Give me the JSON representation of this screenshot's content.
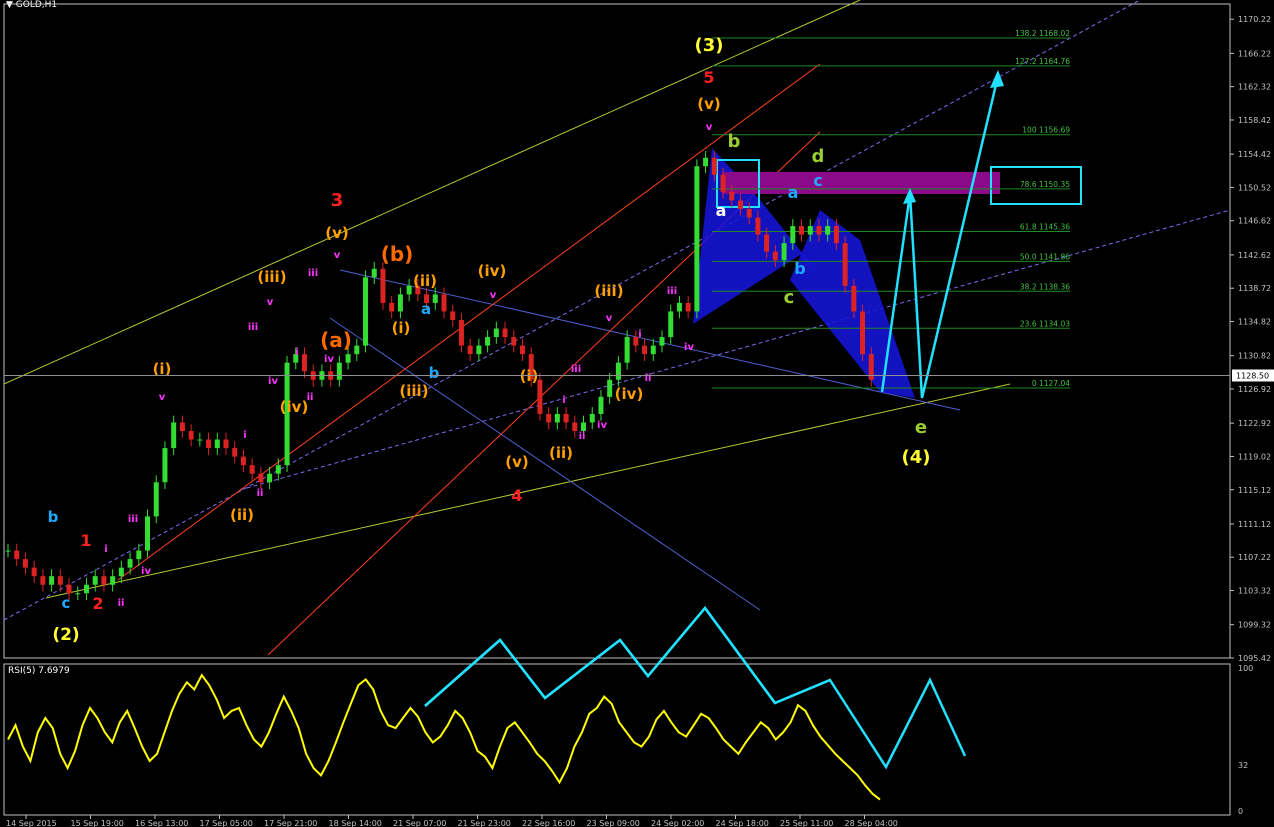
{
  "header": {
    "symbol": "GOLD,H1"
  },
  "rsi": {
    "title": "RSI(5) 7.6979",
    "scale_labels": [
      "100",
      "32",
      "0"
    ],
    "values": [
      50,
      60,
      45,
      35,
      55,
      65,
      58,
      40,
      30,
      42,
      60,
      72,
      65,
      55,
      48,
      62,
      70,
      58,
      45,
      35,
      40,
      55,
      70,
      82,
      90,
      85,
      95,
      88,
      78,
      65,
      70,
      72,
      60,
      50,
      45,
      55,
      68,
      80,
      70,
      58,
      40,
      30,
      25,
      35,
      48,
      62,
      75,
      88,
      92,
      85,
      70,
      60,
      58,
      65,
      72,
      66,
      55,
      48,
      52,
      60,
      70,
      65,
      55,
      42,
      38,
      30,
      45,
      58,
      62,
      55,
      48,
      40,
      35,
      28,
      20,
      30,
      45,
      55,
      68,
      72,
      80,
      75,
      62,
      55,
      48,
      45,
      52,
      64,
      70,
      62,
      55,
      52,
      60,
      68,
      65,
      58,
      50,
      45,
      40,
      48,
      55,
      62,
      58,
      50,
      55,
      62,
      74,
      70,
      60,
      52,
      46,
      40,
      35,
      30,
      25,
      18,
      12,
      8
    ]
  },
  "price_axis": {
    "labels": [
      "1170.22",
      "1166.22",
      "1162.32",
      "1158.42",
      "1154.42",
      "1150.52",
      "1146.62",
      "1142.62",
      "1138.72",
      "1134.82",
      "1130.82",
      "1126.92",
      "1122.92",
      "1119.02",
      "1115.12",
      "1111.12",
      "1107.22",
      "1103.32",
      "1099.32",
      "1095.42"
    ],
    "current": "1128.50"
  },
  "time_axis": {
    "labels": [
      "14 Sep 2015",
      "15 Sep 19:00",
      "16 Sep 13:00",
      "17 Sep 05:00",
      "17 Sep 21:00",
      "18 Sep 14:00",
      "21 Sep 07:00",
      "21 Sep 23:00",
      "22 Sep 16:00",
      "23 Sep 09:00",
      "24 Sep 02:00",
      "24 Sep 18:00",
      "25 Sep 11:00",
      "28 Sep 04:00"
    ]
  },
  "fib_levels": [
    {
      "label": "138.2 1168.02",
      "price": 1168.02
    },
    {
      "label": "127.2 1164.76",
      "price": 1164.76
    },
    {
      "label": "100 1156.69",
      "price": 1156.69
    },
    {
      "label": "78.6 1150.35",
      "price": 1150.35
    },
    {
      "label": "61.8 1145.36",
      "price": 1145.36
    },
    {
      "label": "50.0 1141.86",
      "price": 1141.86
    },
    {
      "label": "38.2 1138.36",
      "price": 1138.36
    },
    {
      "label": "23.6 1134.03",
      "price": 1134.03
    },
    {
      "label": "0 1127.04",
      "price": 1127.04
    }
  ],
  "wave_labels": [
    {
      "text": "(2)",
      "color": "#ffff33"
    },
    {
      "text": "b",
      "color": "#1fa8ff"
    },
    {
      "text": "c",
      "color": "#1fa8ff"
    },
    {
      "text": "1",
      "color": "#ff2020"
    },
    {
      "text": "2",
      "color": "#ff2020"
    },
    {
      "text": "i",
      "color": "#ff33ff"
    },
    {
      "text": "ii",
      "color": "#ff33ff"
    },
    {
      "text": "iii",
      "color": "#ff33ff"
    },
    {
      "text": "iv",
      "color": "#ff33ff"
    },
    {
      "text": "(i)",
      "color": "#ffa000"
    },
    {
      "text": "v",
      "color": "#ff33ff"
    },
    {
      "text": "(ii)",
      "color": "#ffa000"
    },
    {
      "text": "ii",
      "color": "#ff33ff"
    },
    {
      "text": "i",
      "color": "#ff33ff"
    },
    {
      "text": "iii",
      "color": "#ff33ff"
    },
    {
      "text": "iv",
      "color": "#ff33ff"
    },
    {
      "text": "(iii)",
      "color": "#ffa000"
    },
    {
      "text": "v",
      "color": "#ff33ff"
    },
    {
      "text": "(iv)",
      "color": "#ffa000"
    },
    {
      "text": "i",
      "color": "#ff33ff"
    },
    {
      "text": "ii",
      "color": "#ff33ff"
    },
    {
      "text": "iii",
      "color": "#ff33ff"
    },
    {
      "text": "3",
      "color": "#ff2020"
    },
    {
      "text": "(v)",
      "color": "#ffa000"
    },
    {
      "text": "v",
      "color": "#ff33ff"
    },
    {
      "text": "iv",
      "color": "#ff33ff"
    },
    {
      "text": "(a)",
      "color": "#ff6a00"
    },
    {
      "text": "(b)",
      "color": "#ff6a00"
    },
    {
      "text": "(ii)",
      "color": "#ffa000"
    },
    {
      "text": "(i)",
      "color": "#ffa000"
    },
    {
      "text": "a",
      "color": "#1fa8ff"
    },
    {
      "text": "b",
      "color": "#1fa8ff"
    },
    {
      "text": "(iii)",
      "color": "#ffa000"
    },
    {
      "text": "(iv)",
      "color": "#ffa000"
    },
    {
      "text": "v",
      "color": "#ff33ff"
    },
    {
      "text": "(i)",
      "color": "#ffa000"
    },
    {
      "text": "(v)",
      "color": "#ffa000"
    },
    {
      "text": "4",
      "color": "#ff2020"
    },
    {
      "text": "(ii)",
      "color": "#ffa000"
    },
    {
      "text": "i",
      "color": "#ff33ff"
    },
    {
      "text": "iii",
      "color": "#ff33ff"
    },
    {
      "text": "ii",
      "color": "#ff33ff"
    },
    {
      "text": "iv",
      "color": "#ff33ff"
    },
    {
      "text": "(iv)",
      "color": "#ffa000"
    },
    {
      "text": "ii",
      "color": "#ff33ff"
    },
    {
      "text": "(iii)",
      "color": "#ffa000"
    },
    {
      "text": "v",
      "color": "#ff33ff"
    },
    {
      "text": "i",
      "color": "#ff33ff"
    },
    {
      "text": "iii",
      "color": "#ff33ff"
    },
    {
      "text": "iv",
      "color": "#ff33ff"
    },
    {
      "text": "(3)",
      "color": "#ffff33"
    },
    {
      "text": "5",
      "color": "#ff2020"
    },
    {
      "text": "(v)",
      "color": "#ffa000"
    },
    {
      "text": "v",
      "color": "#ff33ff"
    },
    {
      "text": "b",
      "color": "#9acd32"
    },
    {
      "text": "d",
      "color": "#9acd32"
    },
    {
      "text": "a",
      "color": "#ffffff"
    },
    {
      "text": "a",
      "color": "#1fa8ff"
    },
    {
      "text": "c",
      "color": "#1fa8ff"
    },
    {
      "text": "b",
      "color": "#1fa8ff"
    },
    {
      "text": "c",
      "color": "#9acd32"
    },
    {
      "text": "e",
      "color": "#9acd32"
    },
    {
      "text": "(4)",
      "color": "#ffff33"
    }
  ],
  "chart_data": {
    "type": "candlestick",
    "symbol": "GOLD,H1",
    "ylim": [
      1095.42,
      1172.0
    ],
    "closes": [
      1108,
      1107,
      1106,
      1105,
      1104,
      1105,
      1104,
      1103,
      1103,
      1104,
      1105,
      1104,
      1105,
      1106,
      1107,
      1108,
      1112,
      1116,
      1120,
      1123,
      1122,
      1121,
      1121,
      1120,
      1121,
      1120,
      1119,
      1118,
      1117,
      1116,
      1117,
      1118,
      1130,
      1131,
      1129,
      1128,
      1129,
      1128,
      1130,
      1131,
      1132,
      1140,
      1141,
      1137,
      1136,
      1138,
      1139,
      1138,
      1137,
      1138,
      1136,
      1135,
      1132,
      1131,
      1132,
      1133,
      1134,
      1133,
      1132,
      1131,
      1128,
      1124,
      1123,
      1124,
      1123,
      1122,
      1123,
      1124,
      1126,
      1128,
      1130,
      1133,
      1132,
      1131,
      1132,
      1133,
      1136,
      1137,
      1136,
      1153,
      1154,
      1152,
      1150,
      1149,
      1148,
      1147,
      1145,
      1143,
      1142,
      1144,
      1146,
      1145,
      1146,
      1145,
      1146,
      1144,
      1139,
      1136,
      1131,
      1128
    ],
    "current_price": 1128.5
  }
}
